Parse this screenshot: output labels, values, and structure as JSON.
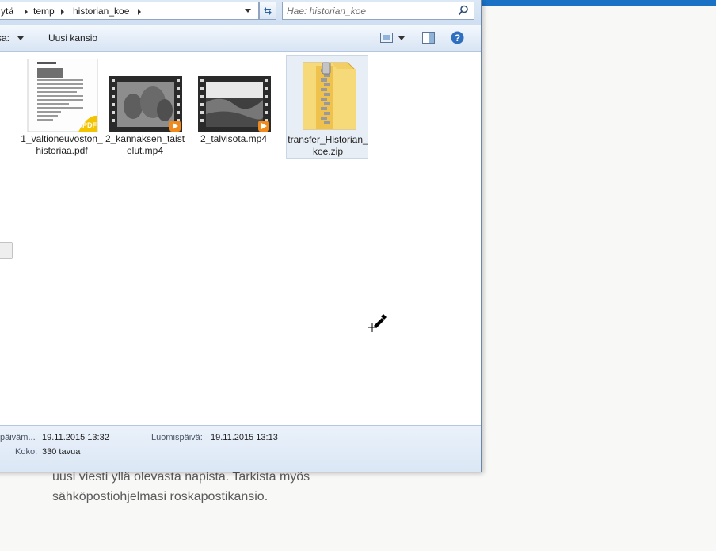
{
  "background_page": {
    "lines": [
      "uusi viesti yllä olevasta napista. Tarkista myös",
      "sähköpostiohjelmasi roskapostikansio."
    ],
    "accent_color": "#1b72c4"
  },
  "explorer": {
    "breadcrumb": [
      {
        "label": "ytä"
      },
      {
        "label": "temp"
      },
      {
        "label": "historian_koe"
      }
    ],
    "search": {
      "placeholder": "Hae: historian_koe"
    },
    "toolbar": {
      "share_label": "ssa:",
      "new_folder_label": "Uusi kansio"
    },
    "files": [
      {
        "name": "1_valtioneuvoston_historiaa.pdf",
        "type": "pdf"
      },
      {
        "name": "2_kannaksen_taistelut.mp4",
        "type": "video"
      },
      {
        "name": "2_talvisota.mp4",
        "type": "video"
      },
      {
        "name": "transfer_Historian_koe.zip",
        "type": "zip",
        "selected": true
      }
    ],
    "details": {
      "modified_label": "päiväm...",
      "modified_value": "19.11.2015 13:32",
      "created_label": "Luomispäivä:",
      "created_value": "19.11.2015 13:13",
      "size_label": "Koko:",
      "size_value": "330 tavua"
    }
  }
}
